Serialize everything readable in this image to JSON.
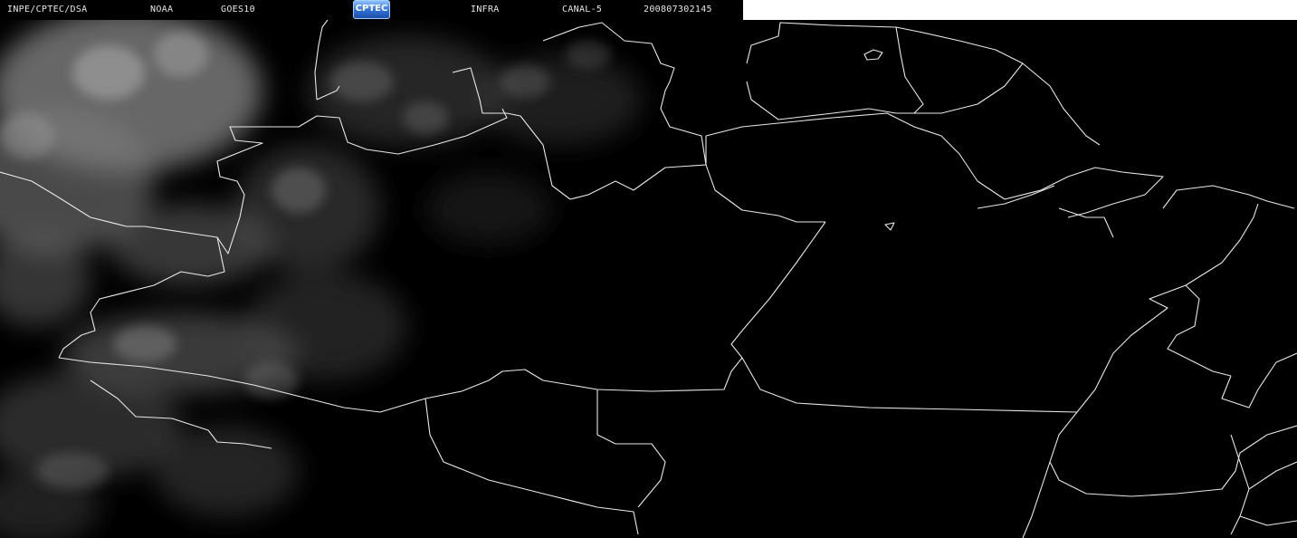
{
  "header": {
    "source": "INPE/CPTEC/DSA",
    "agency": "NOAA",
    "satellite": "GOES10",
    "logo_text": "CPTEC",
    "product": "INFRA",
    "channel": "CANAL-5",
    "timestamp": "200807302145"
  },
  "colors": {
    "background": "#000000",
    "border_lines": "#e8e8e8",
    "cloud": "#9a9a9a",
    "header_text": "#e6e6e6",
    "header_blank": "#ffffff"
  },
  "icons": {
    "logo": "cptec-logo-icon"
  }
}
